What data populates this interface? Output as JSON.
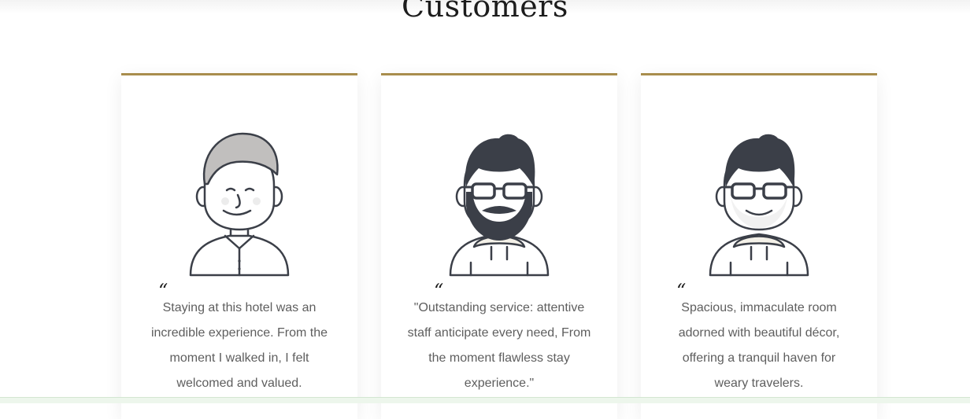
{
  "section": {
    "title": "Customers"
  },
  "testimonials": [
    {
      "text": "Staying at this hotel was an incredible experience. From the moment I walked in, I felt welcomed and valued.",
      "avatar_icon": "man-avatar-gray-hair-icon"
    },
    {
      "text": "\"Outstanding service: attentive staff anticipate every need, From the moment flawless stay experience.\"",
      "avatar_icon": "bearded-man-glasses-avatar-icon"
    },
    {
      "text": "Spacious, immaculate room adorned with beautiful décor, offering a tranquil haven for weary travelers.",
      "avatar_icon": "man-glasses-avatar-icon"
    }
  ],
  "quote_mark": "“",
  "colors": {
    "accent": "#a88d4d",
    "text": "#5e5e5e",
    "heading": "#1c1c1c",
    "outline": "#3b3f48"
  }
}
